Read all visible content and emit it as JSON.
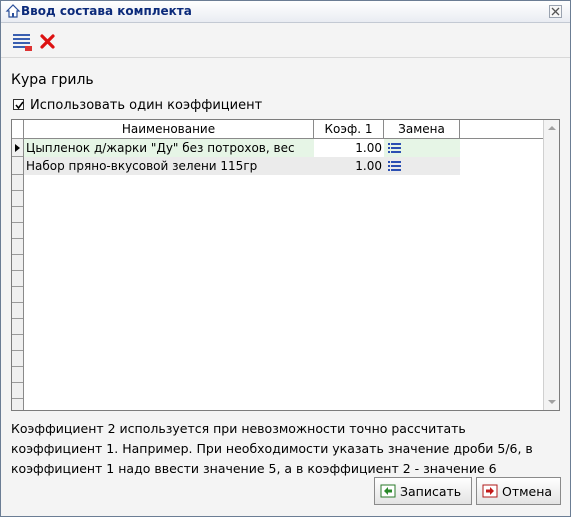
{
  "window": {
    "title": "Ввод состава комплекта"
  },
  "toolbar": {
    "icons": [
      "list-icon",
      "delete-icon"
    ]
  },
  "heading": "Кура гриль",
  "use_single_coef": {
    "label": "Использовать один коэффициент",
    "checked": true
  },
  "table": {
    "columns": [
      "Наименование",
      "Коэф. 1",
      "Замена"
    ],
    "rows": [
      {
        "name": "Цыпленок д/жарки \"Ду\" без потрохов, вес",
        "coef": "1.00",
        "selected": true
      },
      {
        "name": "Набор пряно-вкусовой зелени 115гр",
        "coef": "1.00",
        "selected": false
      }
    ]
  },
  "info_lines": [
    "Коэффициент 2 используется при невозможности точно рассчитать",
    "коэффициент 1. Например. При необходимости указать значение дроби 5/6, в",
    "коэффициент 1 надо ввести значение 5, а в коэффициент 2 - значение 6"
  ],
  "buttons": {
    "save": "Записать",
    "cancel": "Отмена"
  },
  "colors": {
    "selected_row": "#e6f5e6",
    "row2": "#ebebeb",
    "title_text": "#0b2a7a"
  }
}
